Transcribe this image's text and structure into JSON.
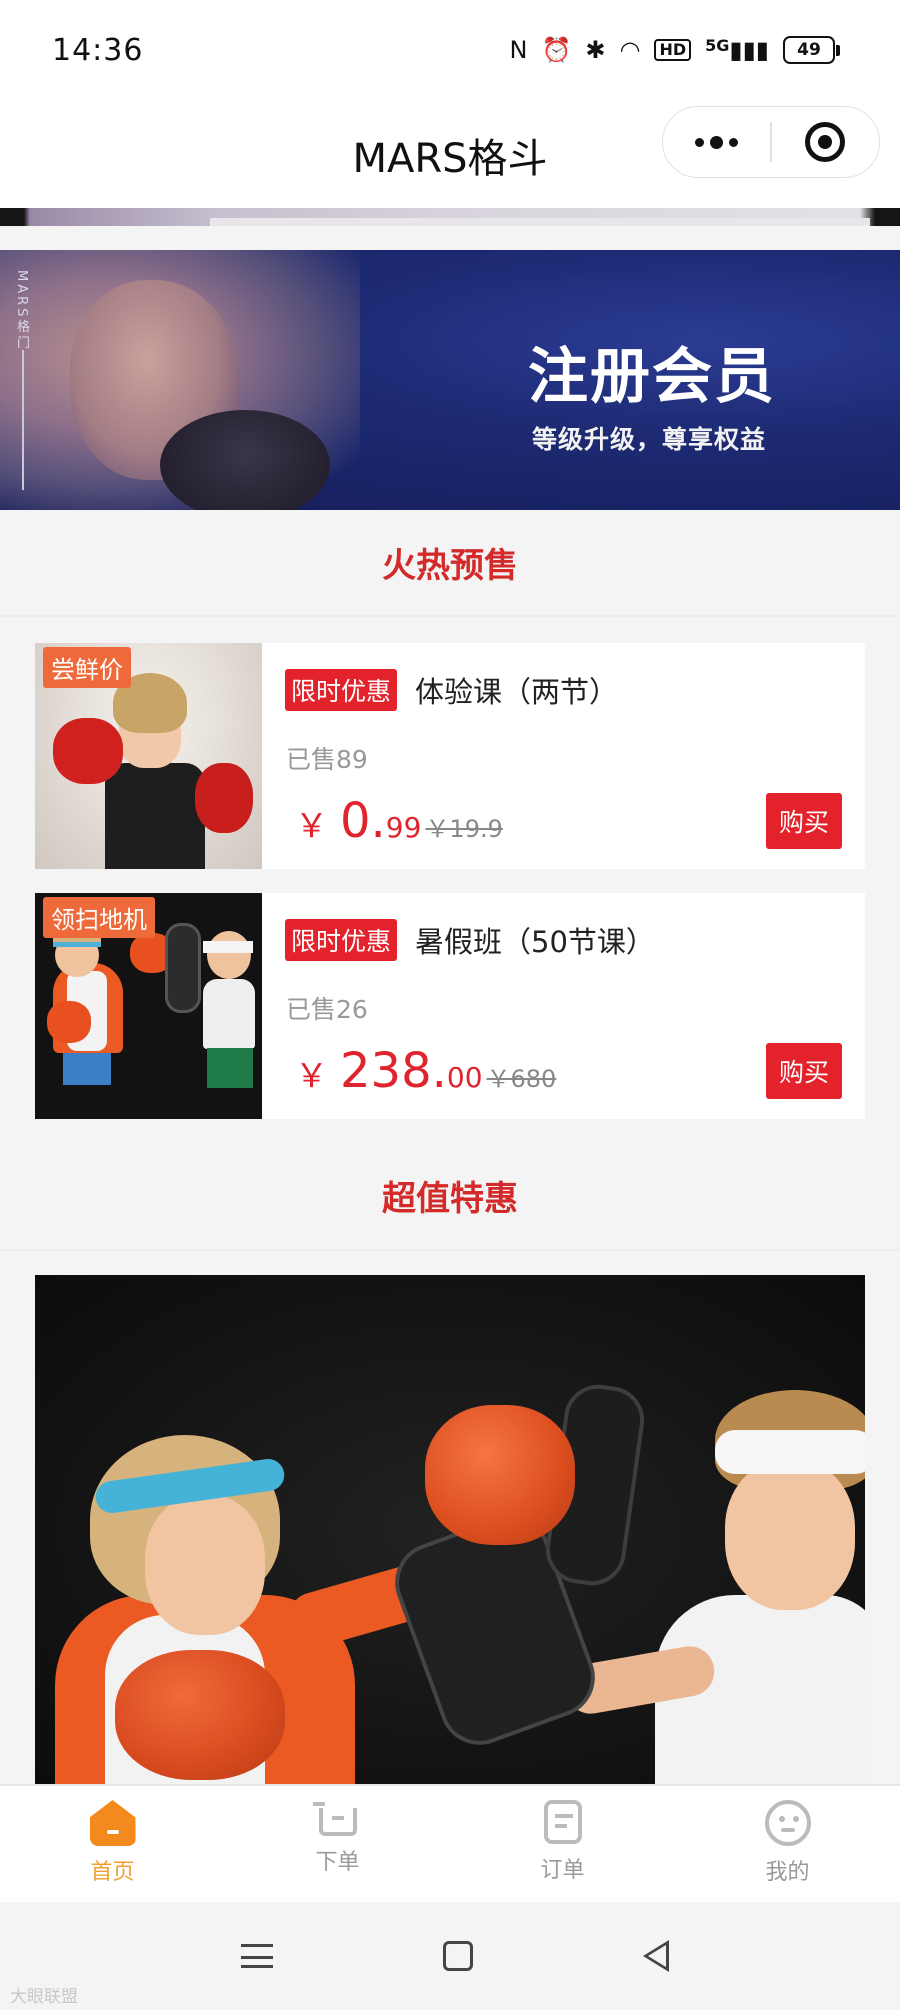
{
  "status_bar": {
    "time": "14:36",
    "network": "5G",
    "hd": "HD",
    "battery": "49"
  },
  "header": {
    "title": "MARS格斗"
  },
  "banner": {
    "side_text": "MARS格门",
    "title": "注册会员",
    "subtitle": "等级升级，尊享权益"
  },
  "sections": {
    "presale_title": "火热预售",
    "special_title": "超值特惠"
  },
  "products": [
    {
      "tag": "尝鲜价",
      "badge": "限时优惠",
      "name": "体验课（两节）",
      "sold": "已售89",
      "currency": "￥",
      "price_int": "0.",
      "price_dec": "99",
      "original_price": "￥19.9",
      "buy_label": "购买"
    },
    {
      "tag": "领扫地机",
      "badge": "限时优惠",
      "name": "暑假班（50节课）",
      "sold": "已售26",
      "currency": "￥",
      "price_int": "238.",
      "price_dec": "00",
      "original_price": "￥680",
      "buy_label": "购买"
    }
  ],
  "tab_bar": {
    "tabs": [
      {
        "label": "首页",
        "icon": "home-icon",
        "active": true
      },
      {
        "label": "下单",
        "icon": "cart-icon",
        "active": false
      },
      {
        "label": "订单",
        "icon": "order-icon",
        "active": false
      },
      {
        "label": "我的",
        "icon": "profile-icon",
        "active": false
      }
    ]
  },
  "watermark": "大眼联盟",
  "colors": {
    "accent_red": "#e3222b",
    "section_red": "#d42a2a",
    "tab_active": "#f0a030",
    "tag_orange": "#ee6a3a"
  }
}
